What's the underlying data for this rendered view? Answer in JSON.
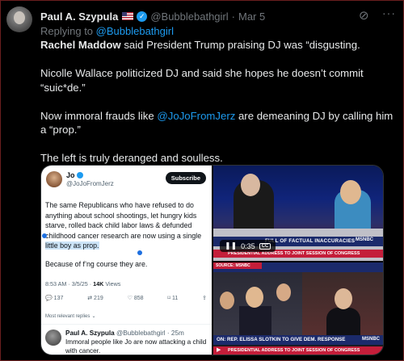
{
  "tweet": {
    "display_name": "Paul A. Szypula",
    "handle": "@Bubblebathgirl",
    "dot": "·",
    "date": "Mar 5",
    "replying_to_prefix": "Replying to",
    "replying_to_handle": "@Bubblebathgirl",
    "body": {
      "line1_name": "Rachel Maddow",
      "line1_rest": " said President Trump praising DJ was “disgusting.",
      "line2": "Nicolle Wallace politicized DJ and said she hopes he doesn’t commit “suic*de.”",
      "line3_before": "Now immoral frauds like ",
      "line3_mention": "@JoJoFromJerz",
      "line3_after": " are demeaning DJ by calling him a “prop.”",
      "line4": "The left is truly deranged and soulless."
    }
  },
  "icons": {
    "grok": "grok-icon",
    "more": "more-icon"
  },
  "media": {
    "screenshot": {
      "name": "Jo",
      "handle": "@JoJoFromJerz",
      "subscribe_label": "Subscribe",
      "text_before": "The same Republicans who have refused to do anything about school shootings, let hungry kids starve, rolled back child labor laws & defunded childhood cancer research are now using a single ",
      "text_highlight": "little boy as prop.",
      "text2": "Because of f’ng course they are.",
      "meta_time": "8:53 AM · 3/5/25 · ",
      "meta_views": "14K",
      "meta_views_label": " Views",
      "actions": [
        "137",
        "219",
        "858",
        "11"
      ],
      "most_relevant": "Most relevant replies",
      "reply_name": "Paul A. Szypula",
      "reply_handle": "@Bubblebathgirl",
      "reply_time": "· 25m",
      "reply_text": "Immoral people like Jo are now attacking a child with cancer."
    },
    "video_top": {
      "time": "0:35",
      "cc": "CC",
      "lower_third": "FULL OF FACTUAL INACCURACIES",
      "brand": "MSNBC",
      "ticker": "PRESIDENTIAL ADDRESS TO JOINT SESSION OF CONGRESS"
    },
    "video_bottom": {
      "top_label": "SOURCE: MSNBC",
      "lower_third": "ON: REP. ELISSA SLOTKIN TO GIVE DEM. RESPONSE",
      "brand": "MSNBC",
      "ticker": "PRESIDENTIAL ADDRESS TO JOINT SESSION OF CONGRESS"
    }
  },
  "colors": {
    "link": "#1d9bf0",
    "background": "#000000",
    "text": "#e7e9ea",
    "muted": "#71767b"
  }
}
